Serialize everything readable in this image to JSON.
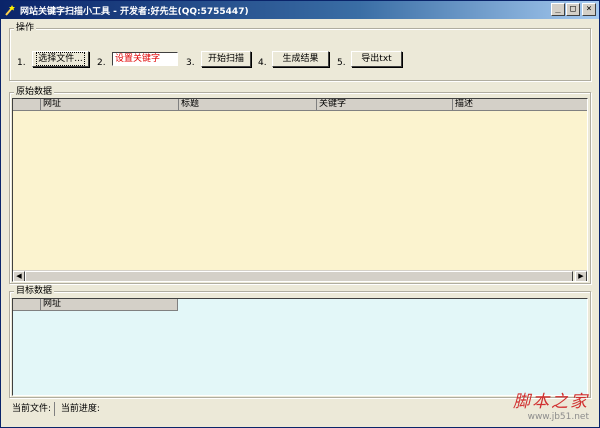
{
  "window": {
    "title": "网站关键字扫描小工具 - 开发者:好先生(QQ:5755447)",
    "controls": {
      "minimize": "_",
      "maximize": "□",
      "close": "×"
    }
  },
  "operations": {
    "legend": "操作",
    "steps": [
      {
        "number": "1.",
        "label": "选择文件..."
      },
      {
        "number": "2.",
        "label": "设置关键字"
      },
      {
        "number": "3.",
        "label": "开始扫描"
      },
      {
        "number": "4.",
        "label": "生成结果"
      },
      {
        "number": "5.",
        "label": "导出txt"
      }
    ]
  },
  "raw_data": {
    "legend": "原始数据",
    "columns": [
      "",
      "网址",
      "标题",
      "关键字",
      "描述"
    ],
    "rows": []
  },
  "target_data": {
    "legend": "目标数据",
    "columns": [
      "",
      "网址"
    ],
    "rows": []
  },
  "status": {
    "current_file_label": "当前文件:",
    "current_progress_label": "当前进度:"
  },
  "watermark": {
    "title": "脚本之家",
    "url": "www.jb51.net"
  },
  "colors": {
    "raw_grid_bg": "#fbf3cf",
    "target_grid_bg": "#e3f7f8",
    "title_bar": "#0a246a",
    "keyword_text": "#e00000"
  }
}
